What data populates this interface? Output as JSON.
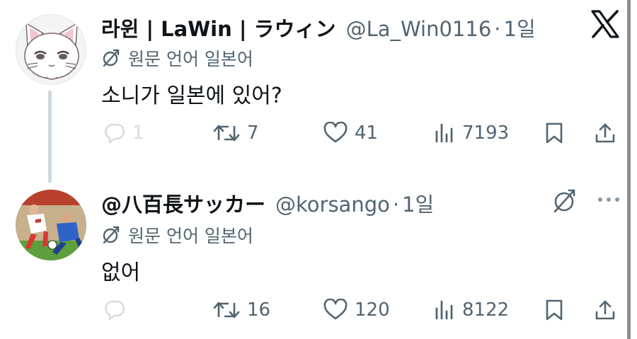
{
  "colors": {
    "text_primary": "#0f1419",
    "text_secondary": "#536471",
    "thread_line": "#cfd9de",
    "reply_faded": "#d6dce0",
    "background": "#ffffff"
  },
  "top_bar": {
    "logo_icon": "x-logo-icon"
  },
  "tweets": [
    {
      "author_name": "라윈 | LaWin | ラウィン",
      "handle": "@La_Win0116",
      "separator": "·",
      "time": "1일",
      "translate_label": "원문 언어 일본어",
      "text": "소니가 일본에 있어?",
      "avatar_icon": "white-cat-avatar",
      "actions": {
        "reply_count": "1",
        "retweet_count": "7",
        "like_count": "41",
        "view_count": "7193"
      }
    },
    {
      "author_name": "@八百長サッカー",
      "handle": "@korsango",
      "separator": "·",
      "time": "1일",
      "translate_label": "원문 언어 일본어",
      "text": "없어",
      "avatar_icon": "soccer-players-avatar",
      "actions": {
        "reply_count": "",
        "retweet_count": "16",
        "like_count": "120",
        "view_count": "8122"
      }
    }
  ]
}
